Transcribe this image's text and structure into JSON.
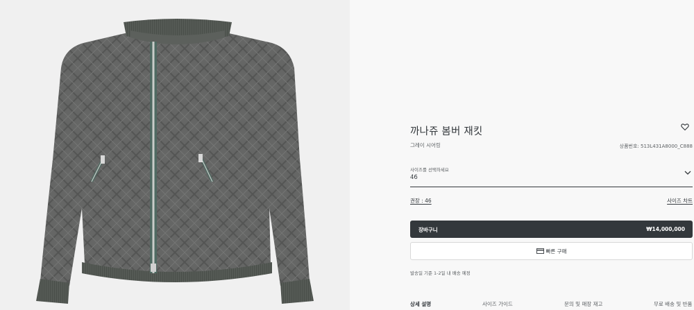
{
  "product": {
    "title": "까나쥬 봄버 재킷",
    "color_name": "그레이 시어링",
    "sku_label": "상품번호:",
    "sku": "513L431A8000_C888",
    "image_icon": "bomber-jacket-image"
  },
  "size_selector": {
    "label": "사이즈를 선택하세요",
    "value": "46"
  },
  "recommended_size": "권장 : 46",
  "size_chart_link": "사이즈 차트",
  "cart": {
    "label": "장바구니",
    "price": "₩14,000,000"
  },
  "quick_buy": {
    "label": "빠른 구매",
    "icon": "card-icon"
  },
  "shipping_note": "발송일 기준 1-2일 내 배송 예정",
  "tabs": [
    {
      "label": "상세 설명",
      "active": true
    },
    {
      "label": "사이즈 가이드",
      "active": false
    },
    {
      "label": "문의 및 매장 재고",
      "active": false
    },
    {
      "label": "무료 배송 및 반품",
      "active": false
    }
  ],
  "colors": {
    "text": "#33383c",
    "muted": "#5d6164",
    "button_dark": "#33383c",
    "jacket": "#6a6b6a",
    "jacket_trim": "#4f554f"
  }
}
